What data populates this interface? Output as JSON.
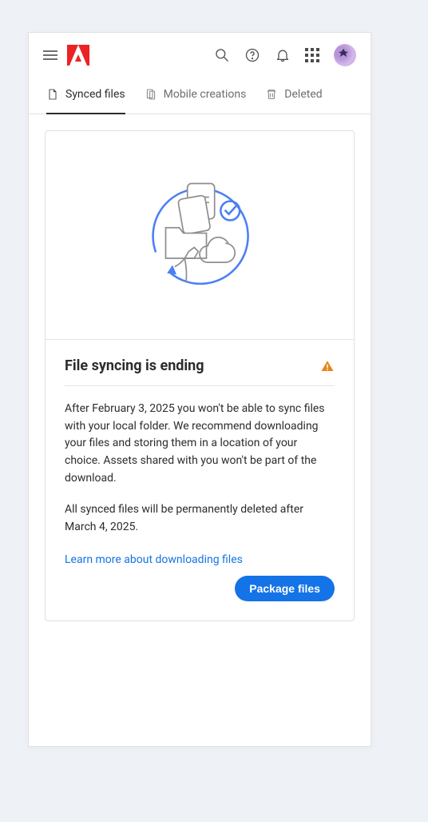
{
  "tabs": {
    "synced": "Synced files",
    "mobile": "Mobile creations",
    "deleted": "Deleted"
  },
  "card": {
    "title": "File syncing is ending",
    "paragraph1": "After February 3, 2025 you won't be able to sync files with your local folder. We recommend downloading your files and storing them in a location of your choice. Assets shared with you won't be part of the download.",
    "paragraph2": "All synced files will be permanently deleted after March 4, 2025.",
    "learn_more": "Learn more about downloading files",
    "button": "Package files"
  }
}
